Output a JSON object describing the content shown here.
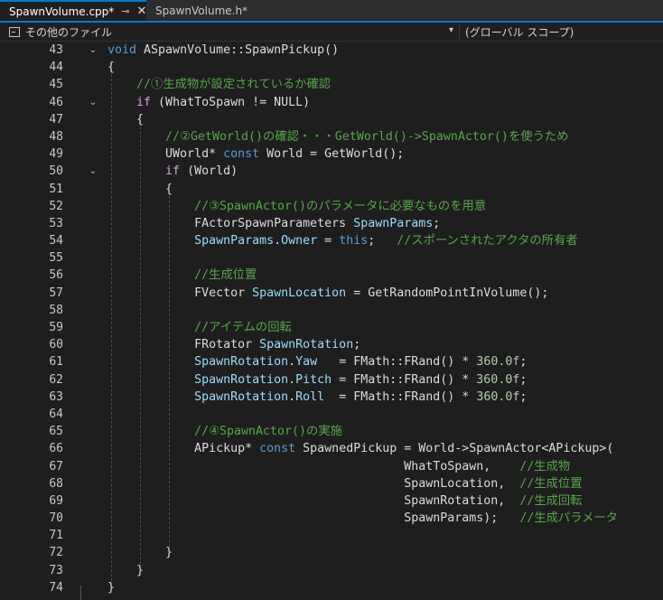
{
  "tabs": [
    {
      "label": "SpawnVolume.cpp*",
      "pin": "⊸",
      "close": "✕"
    },
    {
      "label": "SpawnVolume.h*"
    }
  ],
  "navbar": {
    "left": "その他のファイル",
    "right": "(グローバル スコープ)",
    "dropdown": "▾"
  },
  "lines": [
    {
      "n": "43",
      "fold": "⌄",
      "tokens": [
        [
          "kw",
          "void"
        ],
        [
          "ty",
          " ASpawnVolume::SpawnPickup()"
        ]
      ]
    },
    {
      "n": "44",
      "tokens": [
        [
          "ty",
          "{"
        ]
      ]
    },
    {
      "n": "45",
      "tokens": [
        [
          "cm",
          "    //①生成物が設定されているか確認"
        ]
      ]
    },
    {
      "n": "46",
      "fold": "⌄",
      "tokens": [
        [
          "ctl",
          "    if"
        ],
        [
          "ty",
          " (WhatToSpawn != NULL)"
        ]
      ]
    },
    {
      "n": "47",
      "tokens": [
        [
          "ty",
          "    {"
        ]
      ]
    },
    {
      "n": "48",
      "tokens": [
        [
          "cm",
          "        //②GetWorld()の確認・・・GetWorld()->SpawnActor()を使うため"
        ]
      ]
    },
    {
      "n": "49",
      "tokens": [
        [
          "ty",
          "        UWorld* "
        ],
        [
          "kw",
          "const"
        ],
        [
          "ty",
          " World = GetWorld();"
        ]
      ]
    },
    {
      "n": "50",
      "fold": "⌄",
      "tokens": [
        [
          "ctl",
          "        if"
        ],
        [
          "ty",
          " (World)"
        ]
      ]
    },
    {
      "n": "51",
      "tokens": [
        [
          "ty",
          "        {"
        ]
      ]
    },
    {
      "n": "52",
      "tokens": [
        [
          "cm",
          "            //③SpawnActor()のパラメータに必要なものを用意"
        ]
      ]
    },
    {
      "n": "53",
      "tokens": [
        [
          "ty",
          "            FActorSpawnParameters "
        ],
        [
          "var",
          "SpawnParams"
        ],
        [
          "ty",
          ";"
        ]
      ]
    },
    {
      "n": "54",
      "tokens": [
        [
          "var",
          "            SpawnParams"
        ],
        [
          "ty",
          "."
        ],
        [
          "var",
          "Owner"
        ],
        [
          "ty",
          " = "
        ],
        [
          "kw",
          "this"
        ],
        [
          "ty",
          ";   "
        ],
        [
          "cm",
          "//スポーンされたアクタの所有者"
        ]
      ]
    },
    {
      "n": "55",
      "tokens": []
    },
    {
      "n": "56",
      "tokens": [
        [
          "cm",
          "            //生成位置"
        ]
      ]
    },
    {
      "n": "57",
      "tokens": [
        [
          "ty",
          "            FVector "
        ],
        [
          "var",
          "SpawnLocation"
        ],
        [
          "ty",
          " = GetRandomPointInVolume();"
        ]
      ]
    },
    {
      "n": "58",
      "tokens": []
    },
    {
      "n": "59",
      "tokens": [
        [
          "cm",
          "            //アイテムの回転"
        ]
      ]
    },
    {
      "n": "60",
      "tokens": [
        [
          "ty",
          "            FRotator "
        ],
        [
          "var",
          "SpawnRotation"
        ],
        [
          "ty",
          ";"
        ]
      ]
    },
    {
      "n": "61",
      "tokens": [
        [
          "var",
          "            SpawnRotation"
        ],
        [
          "ty",
          "."
        ],
        [
          "var",
          "Yaw"
        ],
        [
          "ty",
          "   = FMath::FRand() * "
        ],
        [
          "num",
          "360.0f"
        ],
        [
          "ty",
          ";"
        ]
      ]
    },
    {
      "n": "62",
      "tokens": [
        [
          "var",
          "            SpawnRotation"
        ],
        [
          "ty",
          "."
        ],
        [
          "var",
          "Pitch"
        ],
        [
          "ty",
          " = FMath::FRand() * "
        ],
        [
          "num",
          "360.0f"
        ],
        [
          "ty",
          ";"
        ]
      ]
    },
    {
      "n": "63",
      "tokens": [
        [
          "var",
          "            SpawnRotation"
        ],
        [
          "ty",
          "."
        ],
        [
          "var",
          "Roll"
        ],
        [
          "ty",
          "  = FMath::FRand() * "
        ],
        [
          "num",
          "360.0f"
        ],
        [
          "ty",
          ";"
        ]
      ]
    },
    {
      "n": "64",
      "tokens": []
    },
    {
      "n": "65",
      "tokens": [
        [
          "cm",
          "            //④SpawnActor()の実施"
        ]
      ]
    },
    {
      "n": "66",
      "tokens": [
        [
          "ty",
          "            APickup* "
        ],
        [
          "kw",
          "const"
        ],
        [
          "ty",
          " SpawnedPickup = World->SpawnActor<APickup>("
        ]
      ]
    },
    {
      "n": "67",
      "tokens": [
        [
          "ty",
          "                                         WhatToSpawn,    "
        ],
        [
          "cm",
          "//生成物"
        ]
      ]
    },
    {
      "n": "68",
      "tokens": [
        [
          "ty",
          "                                         SpawnLocation,  "
        ],
        [
          "cm",
          "//生成位置"
        ]
      ]
    },
    {
      "n": "69",
      "tokens": [
        [
          "ty",
          "                                         SpawnRotation,  "
        ],
        [
          "cm",
          "//生成回転"
        ]
      ]
    },
    {
      "n": "70",
      "tokens": [
        [
          "ty",
          "                                         SpawnParams);   "
        ],
        [
          "cm",
          "//生成パラメータ"
        ]
      ]
    },
    {
      "n": "71",
      "tokens": []
    },
    {
      "n": "72",
      "tokens": [
        [
          "ty",
          "        }"
        ]
      ]
    },
    {
      "n": "73",
      "tokens": [
        [
          "ty",
          "    }"
        ]
      ]
    },
    {
      "n": "74",
      "tokens": [
        [
          "ty",
          "}"
        ]
      ]
    }
  ]
}
